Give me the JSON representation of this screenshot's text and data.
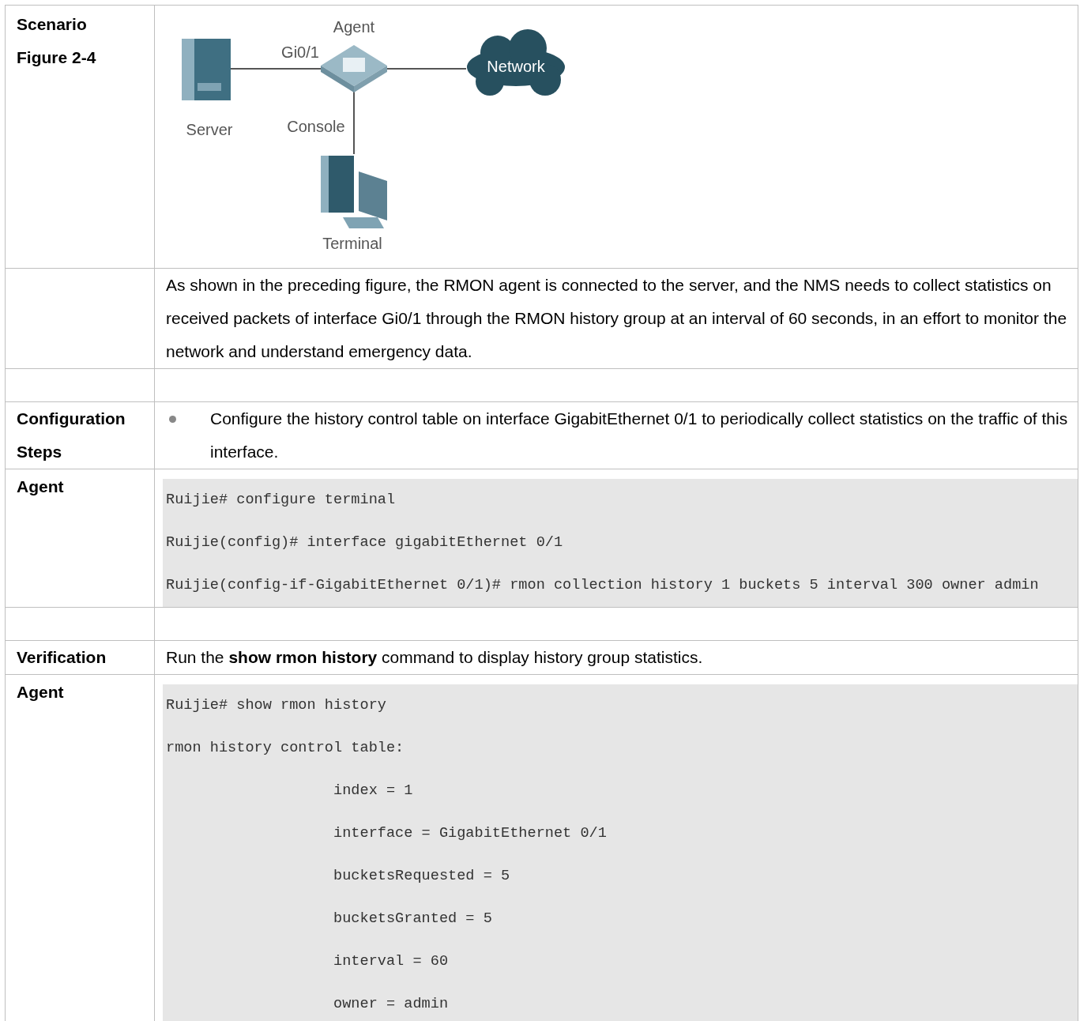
{
  "rows": [
    {
      "kind": "figure",
      "label": [
        "Scenario",
        "Figure 2-4"
      ],
      "figure": {
        "agent": "Agent",
        "port": "Gi0/1",
        "server": "Server",
        "console": "Console",
        "terminal": "Terminal",
        "network": "Network"
      }
    },
    {
      "kind": "text",
      "label": [],
      "text": "As shown in the preceding figure, the RMON agent is connected to the server, and the NMS needs to collect statistics on received packets of interface Gi0/1 through the RMON history group at an interval of 60 seconds, in an effort to monitor the network and understand emergency data."
    },
    {
      "kind": "empty",
      "label": []
    },
    {
      "kind": "bullet",
      "label": [
        "Configuration Steps"
      ],
      "text": "Configure the history control table on interface GigabitEthernet 0/1 to periodically collect statistics on the traffic of this interface."
    },
    {
      "kind": "code",
      "label": [
        "Agent"
      ],
      "lines": [
        "Ruijie# configure terminal",
        "Ruijie(config)# interface gigabitEthernet 0/1",
        "Ruijie(config-if-GigabitEthernet 0/1)# rmon collection history 1 buckets 5 interval 300 owner admin"
      ]
    },
    {
      "kind": "empty",
      "label": []
    },
    {
      "kind": "text",
      "label": [
        "Verification"
      ],
      "text": "Run the **show rmon history** command to display history group statistics."
    },
    {
      "kind": "code",
      "label": [
        "Agent"
      ],
      "lines": [
        "Ruijie# show rmon history",
        "rmon history control table:",
        "                   index = 1",
        "                   interface = GigabitEthernet 0/1",
        "                   bucketsRequested = 5",
        "                   bucketsGranted = 5",
        "                   interval = 60",
        "                   owner = admin"
      ]
    }
  ]
}
